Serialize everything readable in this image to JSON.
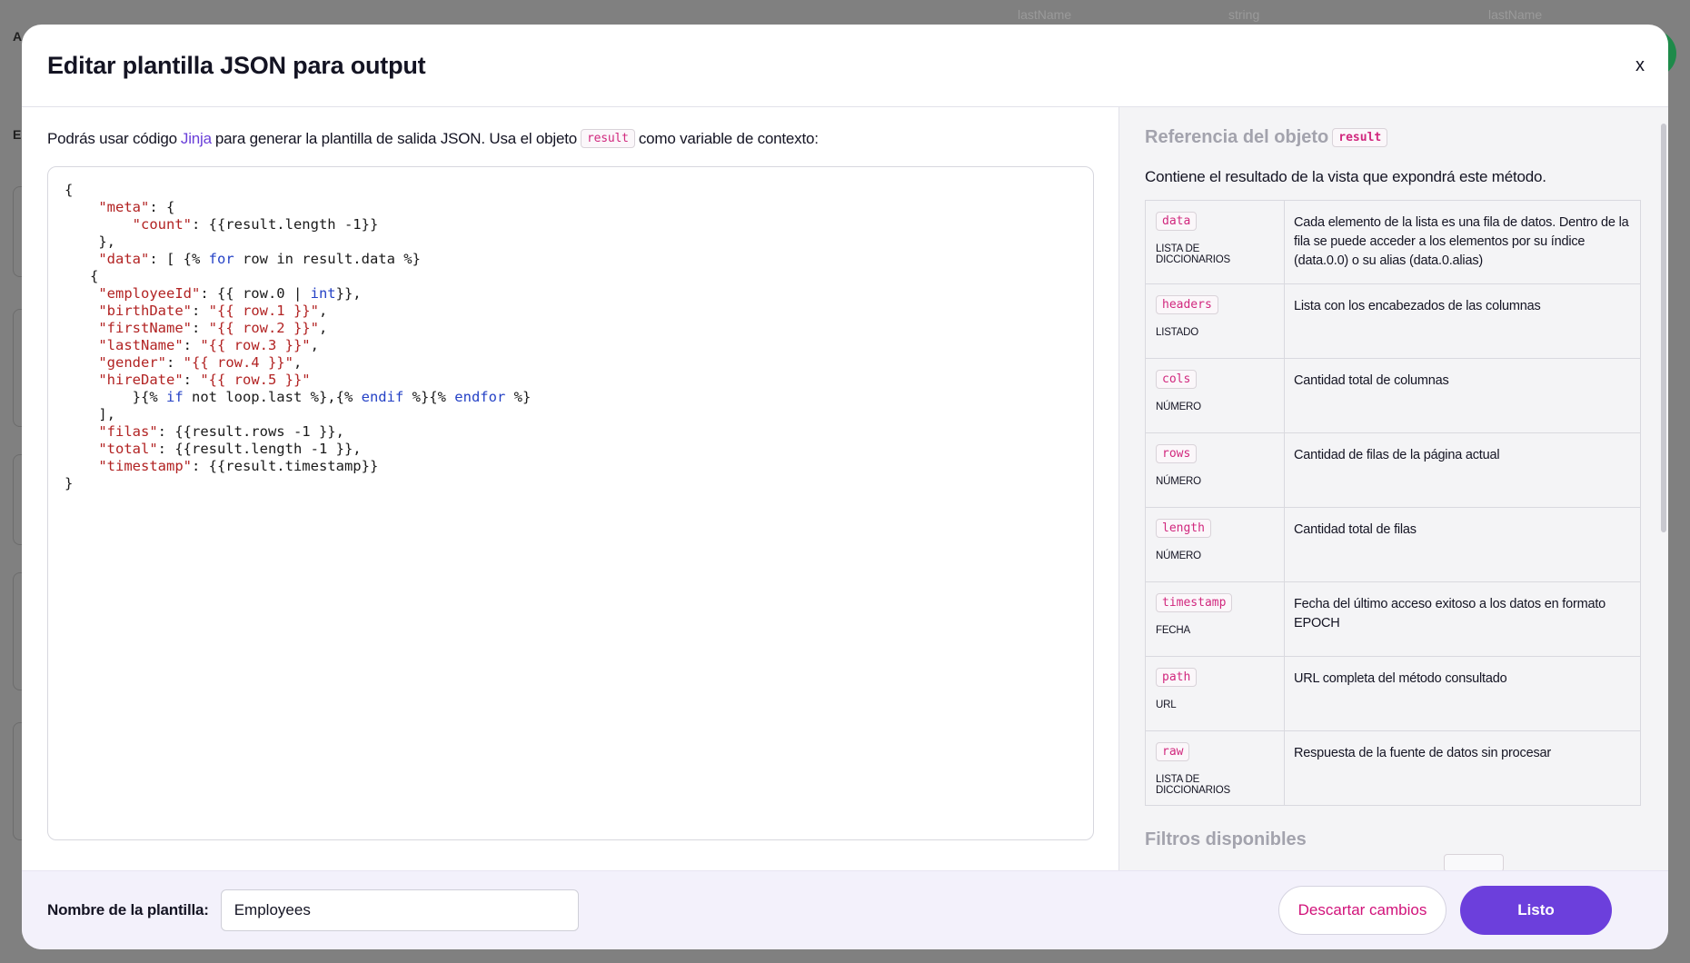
{
  "background": {
    "columns": [
      "lastName",
      "string",
      "lastName"
    ],
    "left_letters": [
      "A",
      "E"
    ]
  },
  "modal": {
    "title": "Editar plantilla JSON para output",
    "close_label": "x"
  },
  "editor": {
    "intro_before": "Podrás usar código",
    "intro_link": "Jinja",
    "intro_middle": "para generar la plantilla de salida JSON. Usa el objeto",
    "intro_code": "result",
    "intro_after": "como variable de contexto:",
    "code_lines": [
      "{",
      "    \"meta\": {",
      "        \"count\": {{result.length -1}}",
      "    },",
      "    \"data\": [ {% for row in result.data %}",
      "   {",
      "    \"employeeId\": {{ row.0 | int}},",
      "    \"birthDate\": \"{{ row.1 }}\",",
      "    \"firstName\": \"{{ row.2 }}\",",
      "    \"lastName\": \"{{ row.3 }}\",",
      "    \"gender\": \"{{ row.4 }}\",",
      "    \"hireDate\": \"{{ row.5 }}\"",
      "        }{% if not loop.last %},{% endif %}{% endfor %}",
      "    ],",
      "    \"filas\": {{result.rows -1 }},",
      "    \"total\": {{result.length -1 }},",
      "    \"timestamp\": {{result.timestamp}}",
      "}"
    ]
  },
  "reference": {
    "title": "Referencia del objeto",
    "title_code": "result",
    "description": "Contiene el resultado de la vista que expondrá este método.",
    "rows": [
      {
        "name": "data",
        "type": "LISTA DE DICCIONARIOS",
        "desc": "Cada elemento de la lista es una fila de datos. Dentro de la fila se puede acceder a los elementos por su índice (data.0.0) o su alias (data.0.alias)"
      },
      {
        "name": "headers",
        "type": "LISTADO",
        "desc": "Lista con los encabezados de las columnas"
      },
      {
        "name": "cols",
        "type": "NÚMERO",
        "desc": "Cantidad total de columnas"
      },
      {
        "name": "rows",
        "type": "NÚMERO",
        "desc": "Cantidad de filas de la página actual"
      },
      {
        "name": "length",
        "type": "NÚMERO",
        "desc": "Cantidad total de filas"
      },
      {
        "name": "timestamp",
        "type": "FECHA",
        "desc": "Fecha del último acceso exitoso a los datos en formato EPOCH"
      },
      {
        "name": "path",
        "type": "URL",
        "desc": "URL completa del método consultado"
      },
      {
        "name": "raw",
        "type": "LISTA DE DICCIONARIOS",
        "desc": "Respuesta de la fuente de datos sin procesar"
      }
    ],
    "filters_title": "Filtros disponibles"
  },
  "footer": {
    "name_label": "Nombre de la plantilla:",
    "name_value": "Employees",
    "discard_label": "Descartar cambios",
    "done_label": "Listo"
  },
  "colors": {
    "accent": "#6c3fdc",
    "discard_text": "#d1127a",
    "code_key": "#b22323",
    "code_keyword": "#2542c6"
  }
}
